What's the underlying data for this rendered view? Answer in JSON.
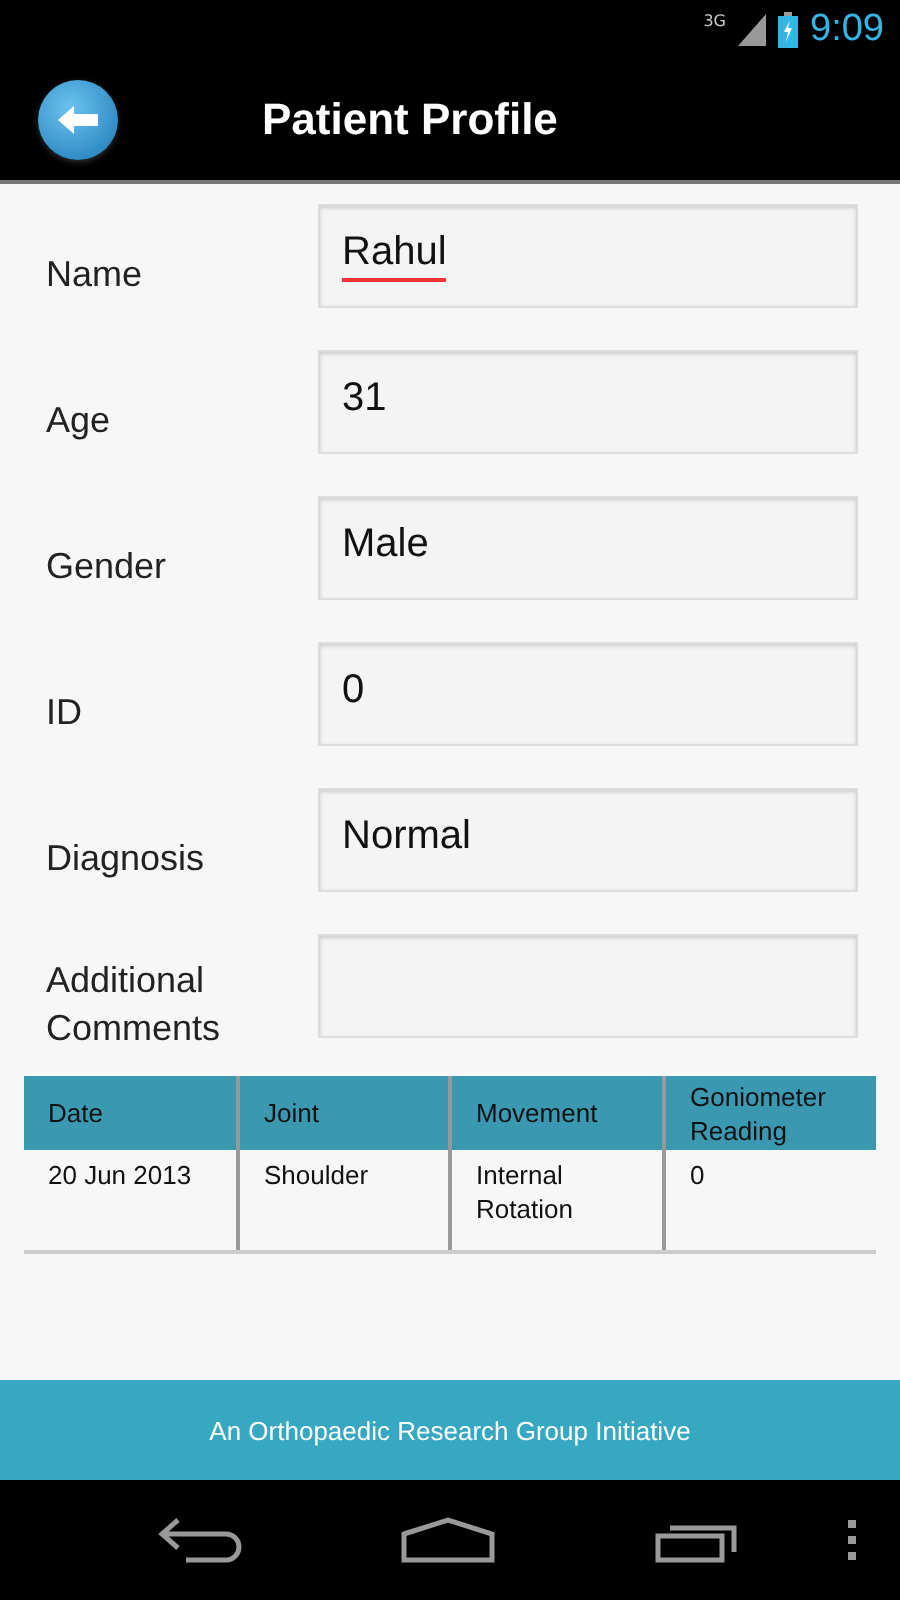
{
  "status_bar": {
    "network": "3G",
    "time": "9:09"
  },
  "title_bar": {
    "title": "Patient Profile"
  },
  "fields": [
    {
      "label": "Name",
      "value": "Rahul",
      "misspelled": true
    },
    {
      "label": "Age",
      "value": "31"
    },
    {
      "label": "Gender",
      "value": "Male"
    },
    {
      "label": "ID",
      "value": "0"
    },
    {
      "label": "Diagnosis",
      "value": "Normal"
    },
    {
      "label": "Additional Comments"
    }
  ],
  "table": {
    "columns": [
      "Date",
      "Joint",
      "Movement",
      "Goniometer Reading"
    ],
    "rows": [
      [
        "20 Jun 2013",
        "Shoulder",
        "Internal Rotation",
        "0"
      ]
    ]
  },
  "footer": {
    "text": "An Orthopaedic Research Group Initiative"
  }
}
